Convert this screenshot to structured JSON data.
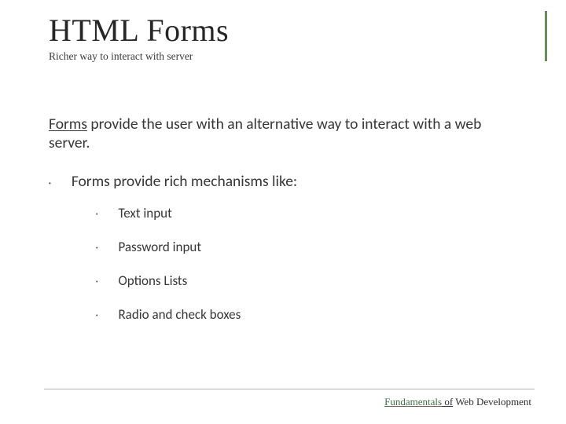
{
  "title": "HTML Forms",
  "subtitle": "Richer way to interact with server",
  "intro_lead": "Forms",
  "intro_rest": " provide the user with an alternative way to interact with a web server.",
  "lvl1_text": "Forms provide rich mechanisms like:",
  "lvl2": {
    "a": "Text input",
    "b": "Password input",
    "c": "Options Lists",
    "d": "Radio and check boxes"
  },
  "footer": {
    "fund": "Fundamentals",
    "of": " of",
    "rest": " Web Development"
  }
}
